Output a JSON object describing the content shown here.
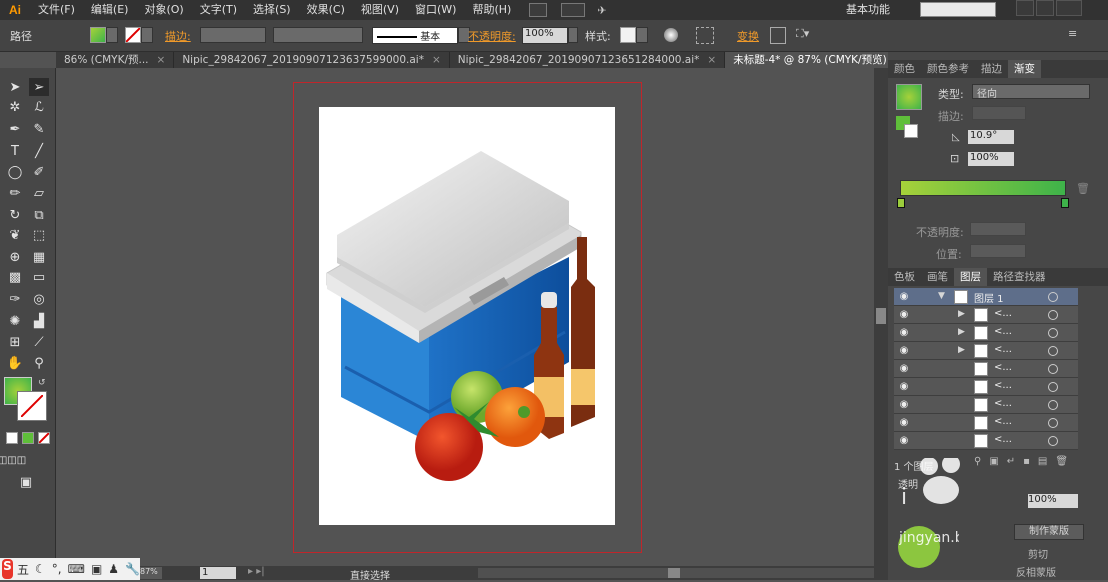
{
  "menubar": {
    "logo": "Ai",
    "items": [
      "文件(F)",
      "编辑(E)",
      "对象(O)",
      "文字(T)",
      "选择(S)",
      "效果(C)",
      "视图(V)",
      "窗口(W)",
      "帮助(H)"
    ],
    "workspace": "基本功能"
  },
  "control": {
    "object_type": "路径",
    "stroke_label": "描边:",
    "stroke_weight_label": "基本",
    "opacity_label": "不透明度:",
    "opacity_value": "100%",
    "style_label": "样式:",
    "transform_label": "变换"
  },
  "tabs": [
    "86% (CMYK/预...",
    "Nipic_29842067_20190907123637599000.ai*",
    "Nipic_29842067_20190907123651284000.ai*",
    "未标题-4* @ 87% (CMYK/预览)"
  ],
  "tab_close": "×",
  "gradient_panel": {
    "tabs": [
      "颜色",
      "颜色参考",
      "描边",
      "渐变"
    ],
    "type_label": "类型:",
    "type_value": "径向",
    "stroke_label": "描边:",
    "angle_value": "10.9°",
    "ratio_value": "100%",
    "opacity_label": "不透明度:",
    "position_label": "位置:",
    "colors": [
      "#a6d13a",
      "#3eb34a"
    ]
  },
  "layers_panel": {
    "tabs": [
      "色板",
      "画笔",
      "图层",
      "路径查找器"
    ],
    "layer_name": "图层 1",
    "sublayer_name": "<...",
    "count_label": "1 个图层"
  },
  "transparency": {
    "title": "透明",
    "opacity_value": "100%",
    "make_mask_label": "制作蒙版",
    "clip_label": "剪切",
    "invert_label": "反相蒙版"
  },
  "status": {
    "zoom": "87%",
    "page": "1",
    "tool_label": "直接选择"
  },
  "taskbar": {
    "ime": "五"
  },
  "watermark": "jingyan.baidu.com"
}
